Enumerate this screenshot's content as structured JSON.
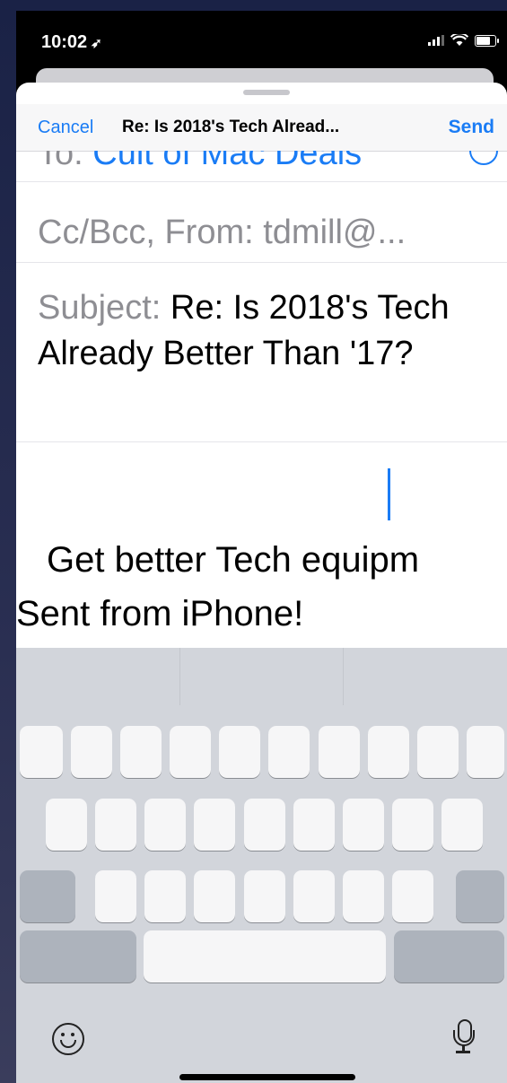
{
  "status_bar": {
    "time": "10:02",
    "location_glyph": "➶"
  },
  "compose": {
    "cancel_label": "Cancel",
    "title": "Re: Is 2018's Tech Alread...",
    "send_label": "Send",
    "to_label": "To:",
    "to_value": "Cult of Mac Deals",
    "cc_from": "Cc/Bcc, From: tdmill@...",
    "subject_label": "Subject:",
    "subject_value": "Re: Is 2018's Tech Already Better Than '17?",
    "body_line1": "Get better Tech equipm",
    "body_line2": "Sent from iPhone!"
  },
  "colors": {
    "accent": "#1a7cf5",
    "label_gray": "#8e8e93",
    "keyboard_bg": "#d2d5db"
  },
  "icons": [
    "cellular-signal-icon",
    "wifi-icon",
    "battery-icon",
    "add-contact-icon",
    "emoji-icon",
    "microphone-icon"
  ]
}
